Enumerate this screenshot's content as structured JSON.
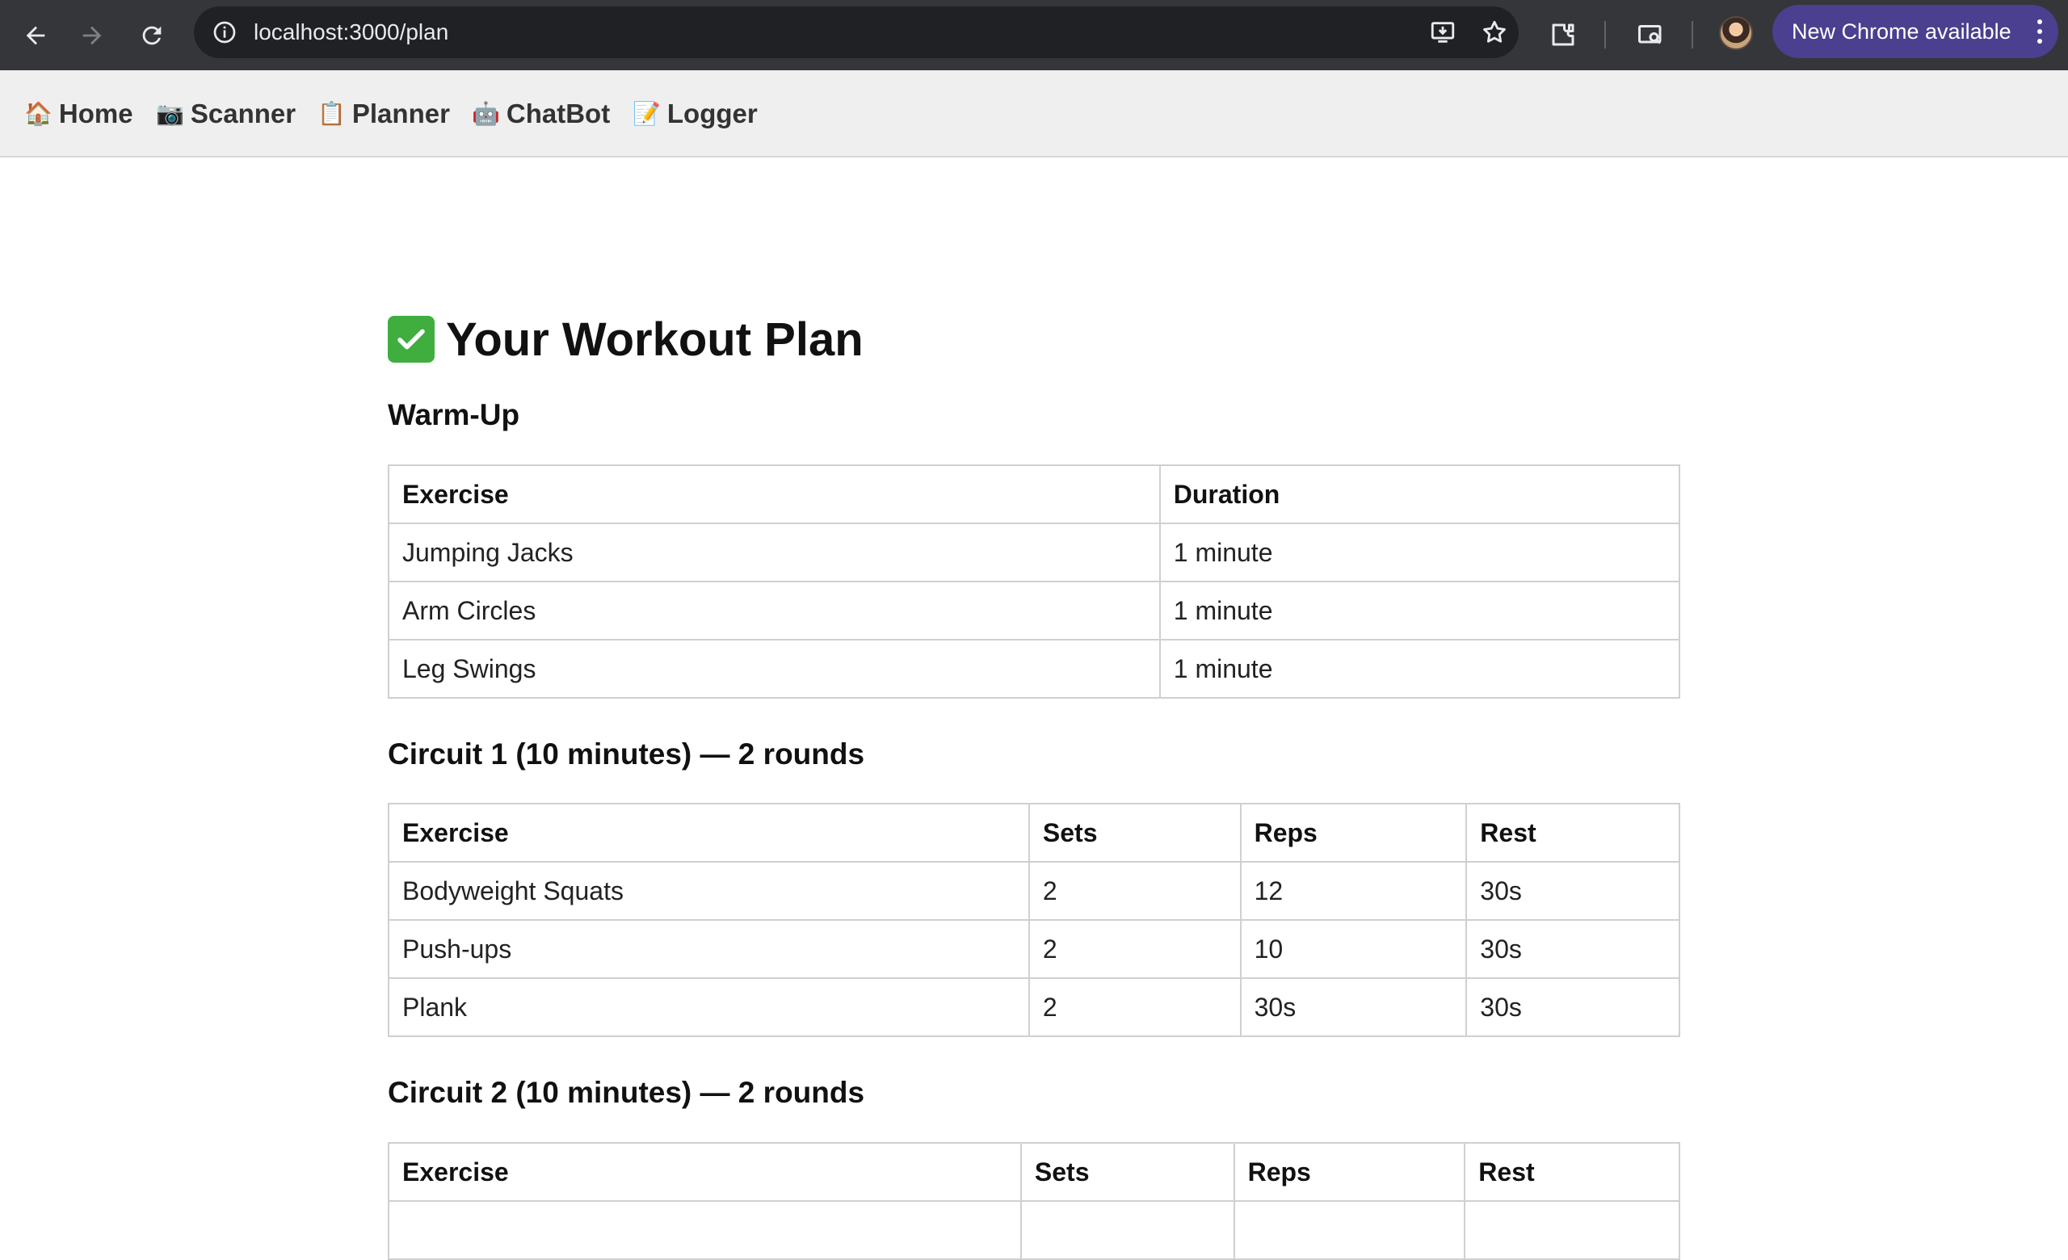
{
  "browser": {
    "url": "localhost:3000/plan",
    "update_label": "New Chrome available"
  },
  "nav": {
    "items": [
      {
        "emoji": "🏠",
        "label": "Home"
      },
      {
        "emoji": "📷",
        "label": "Scanner"
      },
      {
        "emoji": "📋",
        "label": "Planner"
      },
      {
        "emoji": "🤖",
        "label": "ChatBot"
      },
      {
        "emoji": "📝",
        "label": "Logger"
      }
    ]
  },
  "page": {
    "title": "Your Workout Plan"
  },
  "warmup": {
    "title": "Warm-Up",
    "headers": [
      "Exercise",
      "Duration"
    ],
    "rows": [
      [
        "Jumping Jacks",
        "1 minute"
      ],
      [
        "Arm Circles",
        "1 minute"
      ],
      [
        "Leg Swings",
        "1 minute"
      ]
    ]
  },
  "circuit1": {
    "title": "Circuit 1 (10 minutes) — 2 rounds",
    "headers": [
      "Exercise",
      "Sets",
      "Reps",
      "Rest"
    ],
    "rows": [
      [
        "Bodyweight Squats",
        "2",
        "12",
        "30s"
      ],
      [
        "Push-ups",
        "2",
        "10",
        "30s"
      ],
      [
        "Plank",
        "2",
        "30s",
        "30s"
      ]
    ]
  },
  "circuit2": {
    "title": "Circuit 2 (10 minutes) — 2 rounds",
    "headers": [
      "Exercise",
      "Sets",
      "Reps",
      "Rest"
    ]
  }
}
